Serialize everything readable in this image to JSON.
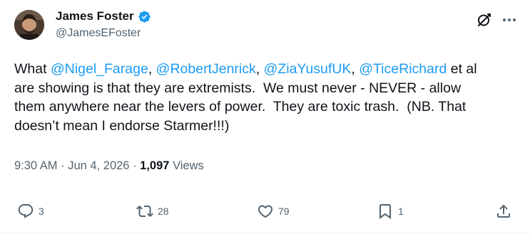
{
  "author": {
    "display_name": "James Foster",
    "handle": "@JamesEFoster",
    "verified": true
  },
  "tweet": {
    "segments": [
      {
        "text": "What ",
        "type": "text"
      },
      {
        "text": "@Nigel_Farage",
        "type": "mention"
      },
      {
        "text": ", ",
        "type": "text"
      },
      {
        "text": "@RobertJenrick",
        "type": "mention"
      },
      {
        "text": ", ",
        "type": "text"
      },
      {
        "text": "@ZiaYusufUK",
        "type": "mention"
      },
      {
        "text": ", ",
        "type": "text"
      },
      {
        "text": "@TiceRichard",
        "type": "mention"
      },
      {
        "text": " et al\nare showing is that they are extremists.  We must never - NEVER - allow\nthem anywhere near the levers of power.  They are toxic trash.  (NB. That\ndoesn’t mean I endorse Starmer!!!)",
        "type": "text"
      }
    ]
  },
  "meta": {
    "time": "9:30 AM",
    "separator": "·",
    "date": "Jun 4, 2026",
    "views_count": "1,097",
    "views_label": "Views"
  },
  "actions": {
    "replies": "3",
    "reposts": "28",
    "likes": "79",
    "bookmarks": "1"
  },
  "colors": {
    "link": "#1d9bf0",
    "secondary_text": "#536471",
    "primary_text": "#0f1419",
    "verified_badge": "#1d9bf0"
  },
  "icons": [
    "verified-badge-icon",
    "grok-icon",
    "more-icon",
    "reply-icon",
    "repost-icon",
    "like-icon",
    "bookmark-icon",
    "share-icon"
  ]
}
